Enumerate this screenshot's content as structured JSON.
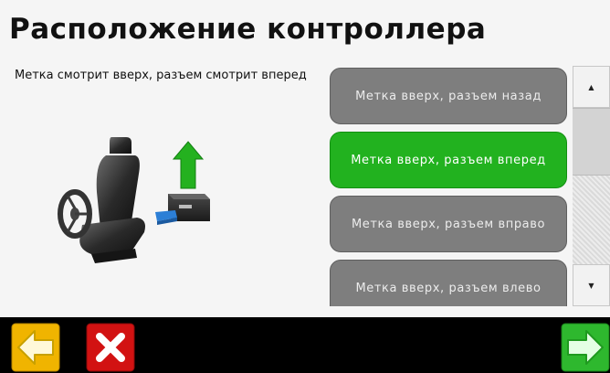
{
  "title": "Расположение контроллера",
  "description": "Метка смотрит вверх, разъем смотрит вперед",
  "options": [
    {
      "label": "Метка вверх, разъем назад",
      "selected": false
    },
    {
      "label": "Метка вверх, разъем вперед",
      "selected": true
    },
    {
      "label": "Метка вверх, разъем вправо",
      "selected": false
    },
    {
      "label": "Метка вверх, разъем влево",
      "selected": false
    }
  ],
  "colors": {
    "option_default": "#7e7e7e",
    "option_selected": "#22b21f",
    "bottom_bar": "#000000",
    "back_button": "#f0b400",
    "cancel_button": "#d21212",
    "next_button": "#2eb82e"
  },
  "icons": {
    "scroll_up": "triangle-up-icon",
    "scroll_down": "triangle-down-icon",
    "back": "arrow-left-icon",
    "cancel": "close-icon",
    "next": "arrow-right-icon",
    "illustration": "seat-controller-illustration"
  }
}
